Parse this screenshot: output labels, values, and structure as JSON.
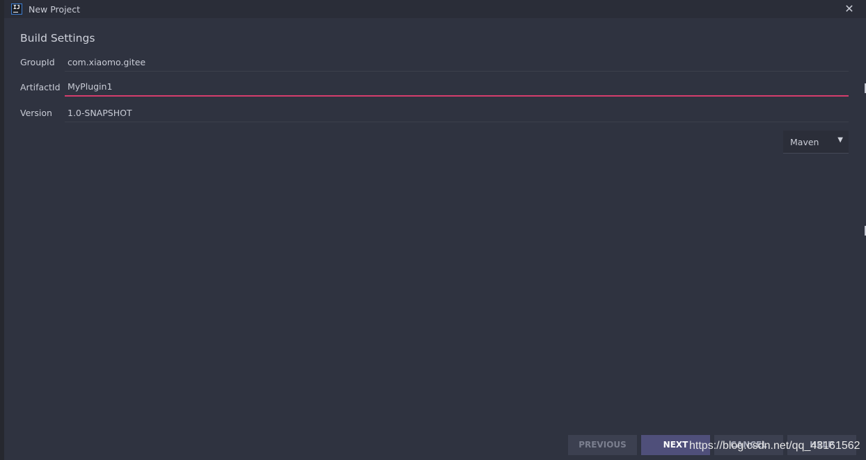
{
  "window": {
    "title": "New Project",
    "app_icon_text": "IJ",
    "close_glyph": "✕"
  },
  "build_settings": {
    "title": "Build Settings",
    "fields": [
      {
        "label": "GroupId",
        "value": "com.xiaomo.gitee"
      },
      {
        "label": "ArtifactId",
        "value": "MyPlugin1"
      },
      {
        "label": "Version",
        "value": "1.0-SNAPSHOT"
      }
    ],
    "build_system": {
      "selected": "Maven",
      "arrow_glyph": "▼"
    }
  },
  "buttons": {
    "previous": "PREVIOUS",
    "next": "NEXT",
    "cancel": "CANCEL",
    "help": "HELP"
  },
  "watermark": "https://blog.csdn.net/qq_43161562",
  "colors": {
    "background": "#2f3340",
    "titlebar": "#2a2d38",
    "focus_underline": "#d63d6d",
    "next_button": "#4f4f7a",
    "secondary_button": "#3c4050"
  }
}
